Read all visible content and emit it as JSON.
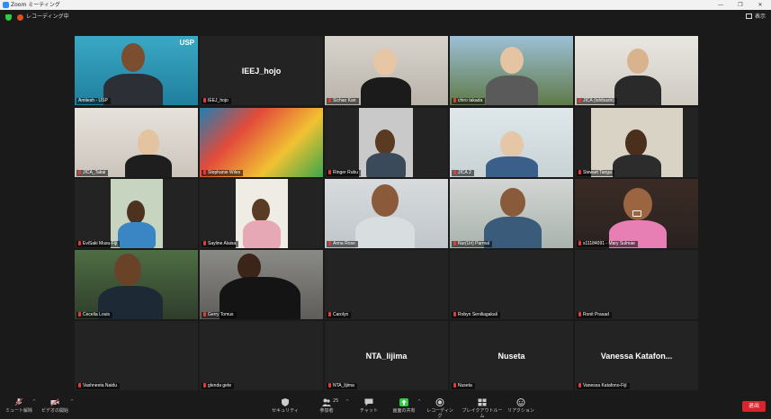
{
  "window": {
    "title": "Zoom ミーティング",
    "minimize": "—",
    "restore": "❐",
    "close": "✕"
  },
  "status": {
    "recording_label": "レコーディング中",
    "view_label": "表示"
  },
  "participants": [
    {
      "name": "Amitesh - USP",
      "big": "",
      "logo": "USP"
    },
    {
      "name": "IEEJ_hojo",
      "big": "IEEJ_hojo"
    },
    {
      "name": "Sichao Kan",
      "big": ""
    },
    {
      "name": "chiro takada",
      "big": ""
    },
    {
      "name": "JICA (Ishibashi)",
      "big": ""
    },
    {
      "name": "JICA_Takai",
      "big": ""
    },
    {
      "name": "Stephanie Wiles",
      "big": ""
    },
    {
      "name": "Ringer Rubu",
      "big": ""
    },
    {
      "name": "JICA 2",
      "big": ""
    },
    {
      "name": "Stewart Tanga",
      "big": ""
    },
    {
      "name": "EviSaki Musu-Fiji",
      "big": ""
    },
    {
      "name": "Sayline Alaisa",
      "big": ""
    },
    {
      "name": "Anna Rose",
      "big": ""
    },
    {
      "name": "Nur(Uri) Parmal",
      "big": ""
    },
    {
      "name": "s11184091 - Mary Sulmae",
      "big": ""
    },
    {
      "name": "Cecelia Louis",
      "big": ""
    },
    {
      "name": "Gerry Tomus",
      "big": ""
    },
    {
      "name": "Carolyn",
      "big": ""
    },
    {
      "name": "Robyn Seniliagakali",
      "big": ""
    },
    {
      "name": "Ronit Prasad",
      "big": ""
    },
    {
      "name": "Vashneeta Naidu",
      "big": ""
    },
    {
      "name": "glenda gete",
      "big": ""
    },
    {
      "name": "NTA_lijima",
      "big": "NTA_lijima"
    },
    {
      "name": "Nuseta",
      "big": "Nuseta"
    },
    {
      "name": "Vanessa Katafono-Fiji",
      "big": "Vanessa  Katafon..."
    }
  ],
  "toolbar": {
    "mute": "ミュート解除",
    "video": "ビデオの開始",
    "security": "セキュリティ",
    "participants": "参加者",
    "participants_count": "25",
    "chat": "チャット",
    "share": "画面の共有",
    "record": "レコーディング",
    "breakout": "ブレイクアウトルーム",
    "reactions": "リアクション",
    "end": "退出"
  },
  "colors": {
    "active_speaker": "#c6e84a",
    "end_button": "#d9232d",
    "share_icon": "#2ecc40",
    "muted_icon": "#e23b3b"
  }
}
